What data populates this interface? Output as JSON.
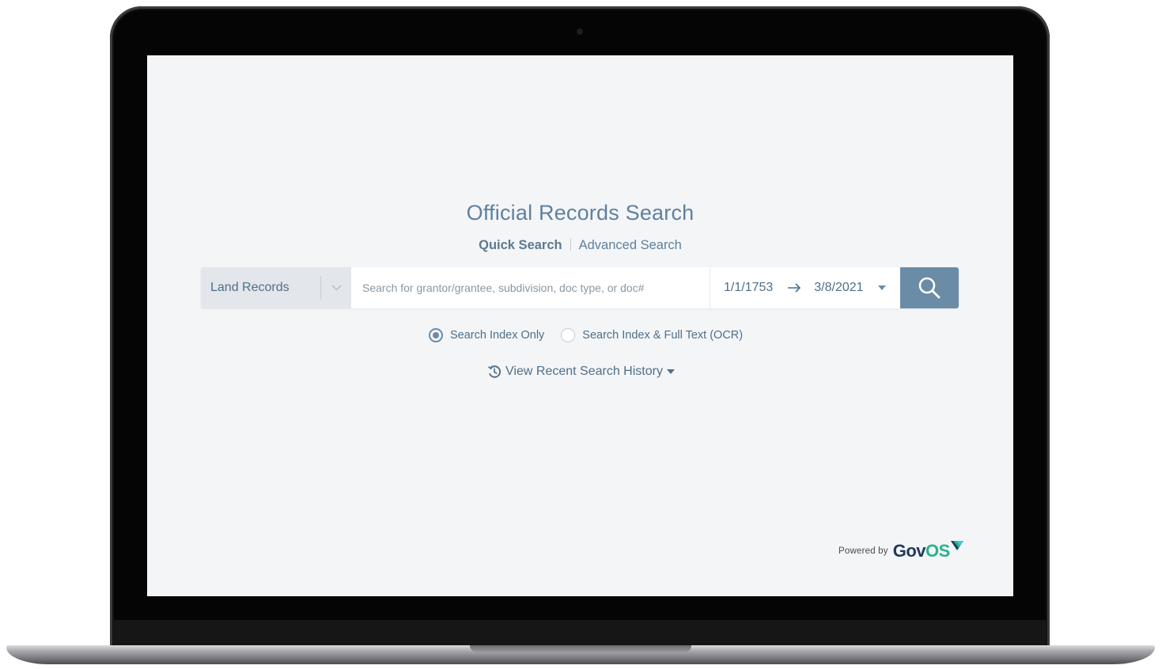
{
  "page": {
    "title": "Official Records Search",
    "modes": {
      "quick": "Quick Search",
      "advanced": "Advanced Search"
    }
  },
  "search": {
    "department": "Land Records",
    "placeholder": "Search for grantor/grantee, subdivision, doc type, or doc#",
    "query_value": "",
    "date_from": "1/1/1753",
    "date_to": "3/8/2021"
  },
  "options": {
    "index_only": "Search Index Only",
    "index_full_text": "Search Index & Full Text (OCR)",
    "selected": "index_only"
  },
  "history": {
    "label": "View Recent Search History"
  },
  "footer": {
    "powered_by": "Powered by",
    "brand_part1": "Gov",
    "brand_part2": "OS"
  },
  "colors": {
    "accent": "#6a8ca6",
    "text": "#4f6f88",
    "screen_background": "#f4f5f7",
    "brand_navy": "#1e3a5c",
    "brand_green": "#27b38e"
  },
  "icons": {
    "department_dropdown": "chevron-down-icon",
    "date_separator": "arrow-right-icon",
    "date_dropdown": "caret-down-icon",
    "submit": "search-icon",
    "history": "history-icon",
    "history_toggle": "caret-down-icon"
  }
}
